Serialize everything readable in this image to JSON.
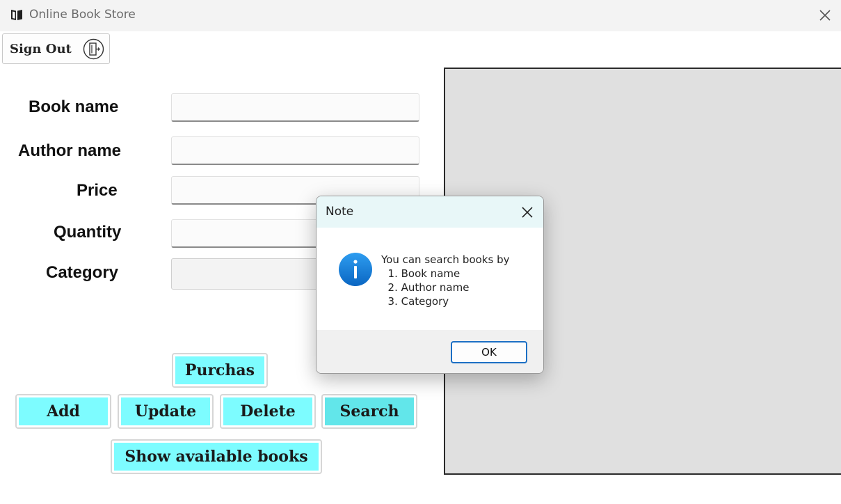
{
  "window": {
    "title": "Online Book Store",
    "icon": "book-icon"
  },
  "signout": {
    "label": "Sign Out",
    "icon": "door-exit-icon"
  },
  "form": {
    "book_name_label": "Book name",
    "author_name_label": "Author name",
    "price_label": "Price",
    "quantity_label": "Quantity",
    "category_label": "Category"
  },
  "buttons": {
    "purchase": "Purchas",
    "add": "Add",
    "update": "Update",
    "delete": "Delete",
    "search": "Search",
    "show_available": "Show available books"
  },
  "colors": {
    "button_face": "#7dfcff",
    "button_active": "#62e6ea",
    "canvas": "#e0e0e0",
    "dialog_ok_border": "#1c6fc4"
  },
  "dialog": {
    "title": "Note",
    "icon": "info-icon",
    "message": [
      "You can search books by",
      "  1. Book name",
      "  2. Author name",
      "  3. Category"
    ],
    "ok_label": "OK"
  }
}
